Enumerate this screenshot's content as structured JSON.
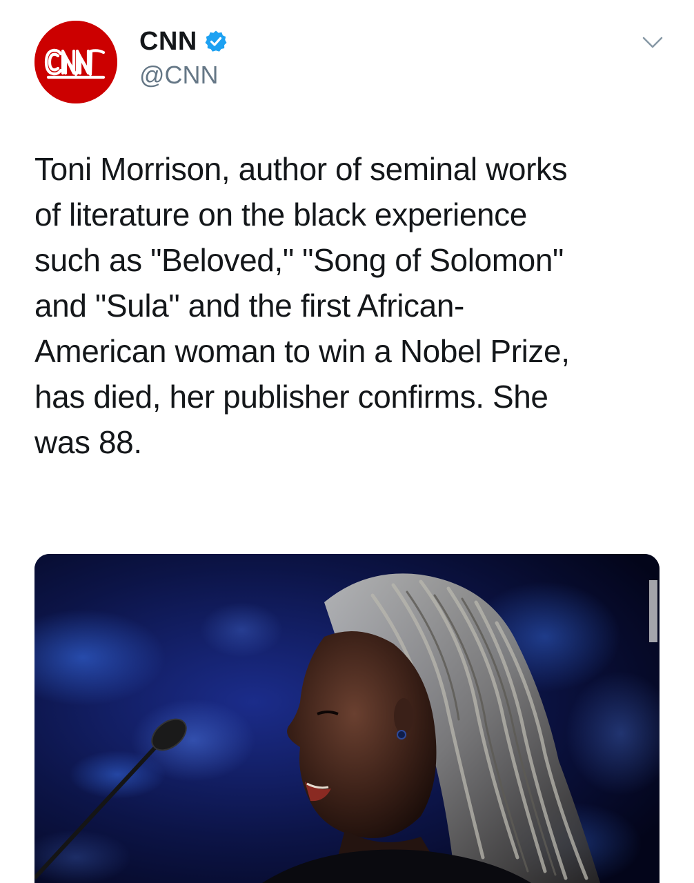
{
  "header": {
    "avatar_text": "CNN",
    "display_name": "CNN",
    "verified_icon": "verified-badge-icon",
    "handle": "@CNN",
    "menu_icon": "chevron-down-icon"
  },
  "tweet": {
    "lines": [
      "Toni Morrison, author of seminal works",
      "of literature on the black experience",
      "such as \"Beloved,\" \"Song of Solomon\"",
      "and \"Sula\" and the first African-",
      "American woman to win a Nobel Prize,",
      "has died, her publisher confirms. She",
      "was 88."
    ]
  },
  "media": {
    "type": "photo",
    "subject": "photo-of-speaker-at-microphone"
  },
  "colors": {
    "brand_red": "#cc0000",
    "verified_blue": "#1da1f2",
    "text_primary": "#14171a",
    "text_secondary": "#657786"
  }
}
